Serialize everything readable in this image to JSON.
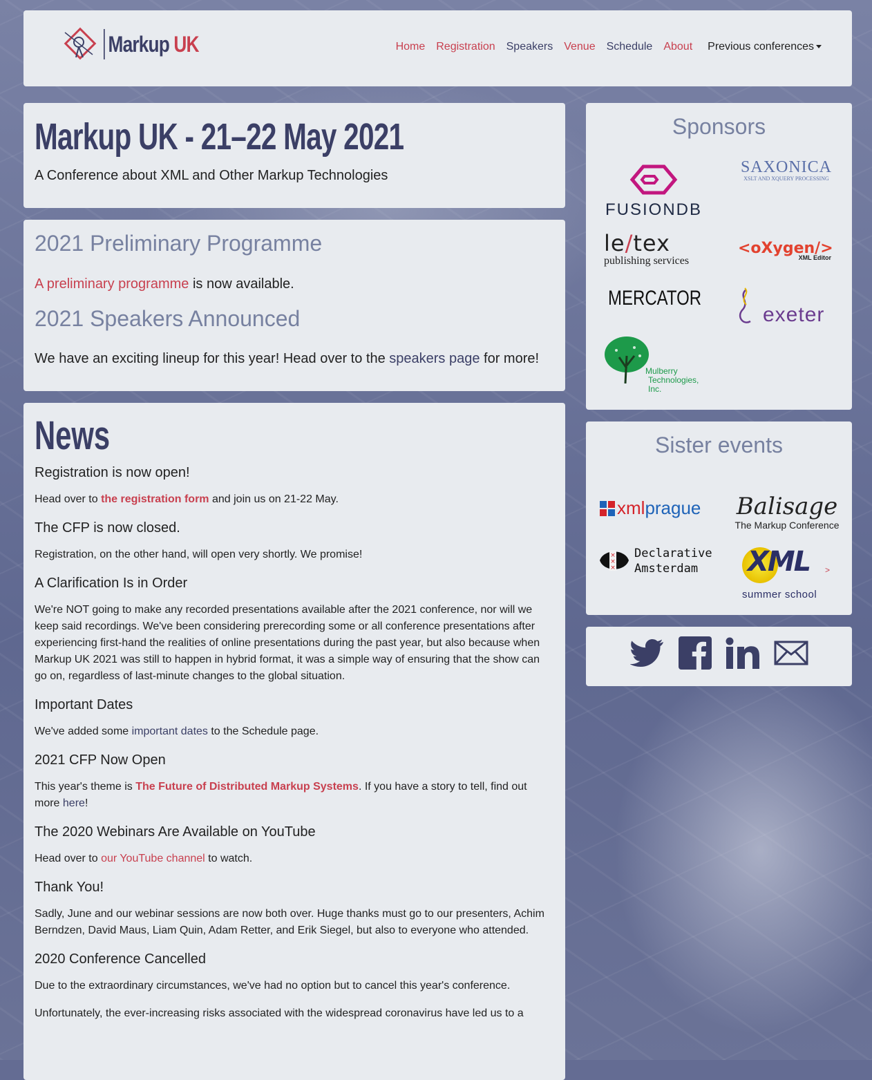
{
  "header": {
    "brand_part1": "Markup",
    "brand_part2": "UK",
    "nav": {
      "home": "Home",
      "registration": "Registration",
      "speakers": "Speakers",
      "venue": "Venue",
      "schedule": "Schedule",
      "about": "About",
      "previous": "Previous conferences"
    }
  },
  "title_panel": {
    "title": "Markup UK - 21–22 May 2021",
    "subtitle": "A Conference about XML and Other Markup Technologies"
  },
  "programme_panel": {
    "heading1": "2021 Preliminary Programme",
    "p1_link": "A preliminary programme",
    "p1_rest": " is now available.",
    "heading2": "2021 Speakers Announced",
    "p2_start": "We have an exciting lineup for this year! Head over to the ",
    "p2_link": "speakers page",
    "p2_end": " for more!"
  },
  "news": {
    "title": "News",
    "items": [
      {
        "heading": "Registration is now open!",
        "pre": "Head over to ",
        "link": "the registration form",
        "post": " and join us on 21-22 May."
      },
      {
        "heading": "The CFP is now closed.",
        "text": "Registration, on the other hand, will open very shortly. We promise!"
      },
      {
        "heading": "A Clarification Is in Order",
        "text": "We're NOT going to make any recorded presentations available after the 2021 conference, nor will we keep said recordings. We've been considering prerecording some or all conference presentations after experiencing first-hand the realities of online presentations during the past year, but also because when Markup UK 2021 was still to happen in hybrid format, it was a simple way of ensuring that the show can go on, regardless of last-minute changes to the global situation."
      },
      {
        "heading": "Important Dates",
        "pre": "We've added some ",
        "link": "important dates",
        "post": " to the Schedule page."
      },
      {
        "heading": "2021 CFP Now Open",
        "pre": "This year's theme is ",
        "link": "The Future of Distributed Markup Systems",
        "mid": ". If you have a story to tell, find out more ",
        "link2": "here",
        "post": "!"
      },
      {
        "heading": "The 2020 Webinars Are Available on YouTube",
        "pre": "Head over to ",
        "link": "our YouTube channel",
        "post": " to watch."
      },
      {
        "heading": "Thank You!",
        "text": "Sadly, June and our webinar sessions are now both over. Huge thanks must go to our presenters, Achim Berndzen, David Maus, Liam Quin, Adam Retter, and Erik Siegel, but also to everyone who attended."
      },
      {
        "heading": "2020 Conference Cancelled",
        "text": "Due to the extraordinary circumstances, we've had no option but to cancel this year's conference."
      },
      {
        "text": "Unfortunately, the ever-increasing risks associated with the widespread coronavirus have led us to a"
      }
    ]
  },
  "sponsors": {
    "heading": "Sponsors",
    "fusiondb": "FUSIONDB",
    "saxonica": "SAXONICA",
    "saxonica_tag": "XSLT AND XQUERY PROCESSING",
    "letex_a": "le",
    "letex_b": "tex",
    "letex_tag": "publishing services",
    "oxygen": "<oXygen/>",
    "oxygen_tag": "XML Editor",
    "mercator": "MERCATOR",
    "exeter": "exeter",
    "mulberry_1": "Mulberry",
    "mulberry_2": "Technologies, Inc."
  },
  "sisters": {
    "heading": "Sister events",
    "xmlprague_a": "xml",
    "xmlprague_b": "prague",
    "balisage": "Balisage",
    "balisage_tag": "The Markup Conference",
    "declarative_1": "Declarative",
    "declarative_2": "Amsterdam",
    "xml_ss": "XML",
    "xml_ss_tag": "summer school",
    "xml_ss_arrow": ">"
  },
  "colors": {
    "accent_red": "#c8404f",
    "accent_navy": "#3b3f66",
    "heading_gray": "#7781a0",
    "panel": "#e8ebef"
  },
  "social_icons": [
    "twitter-icon",
    "facebook-icon",
    "linkedin-icon",
    "email-icon"
  ]
}
